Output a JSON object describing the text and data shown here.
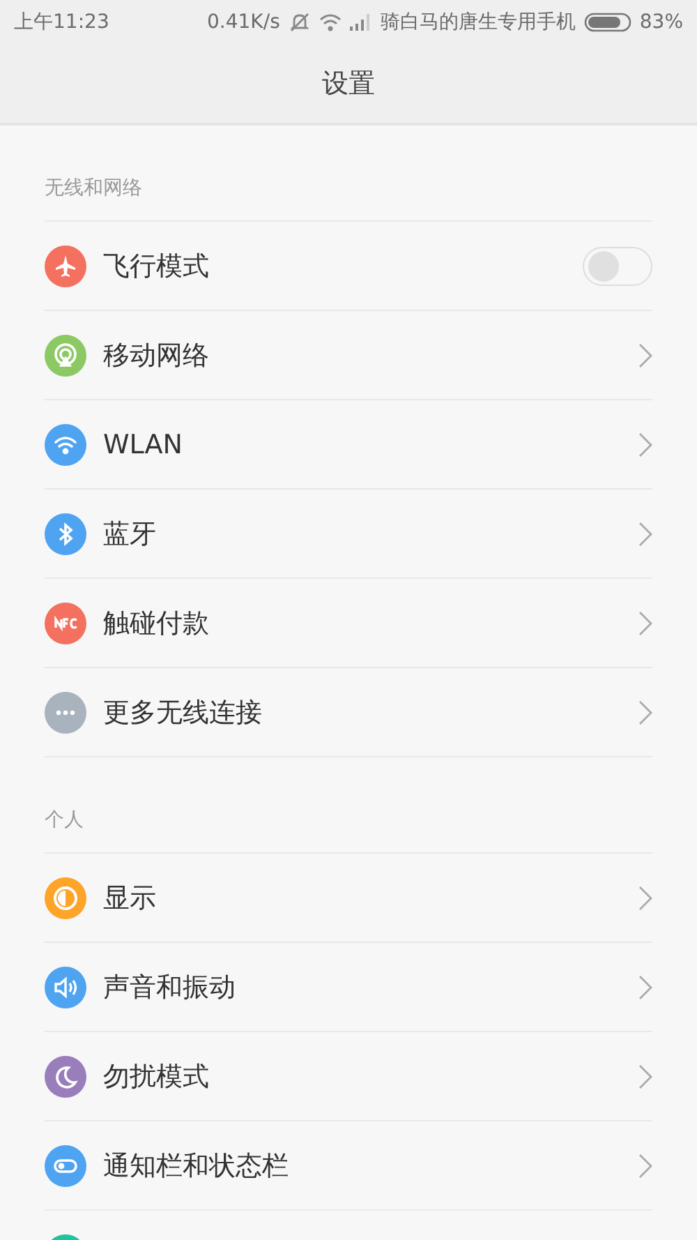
{
  "status_bar": {
    "time": "上午11:23",
    "speed": "0.41K/s",
    "carrier": "骑白马的唐生专用手机",
    "battery": "83%"
  },
  "title": "设置",
  "sections": [
    {
      "header": "无线和网络",
      "items": [
        {
          "label": "飞行模式",
          "kind": "toggle",
          "on": false,
          "color": "#f4705f"
        },
        {
          "label": "移动网络",
          "kind": "link",
          "color": "#8cc964"
        },
        {
          "label": "WLAN",
          "kind": "link",
          "color": "#4fa4f2"
        },
        {
          "label": "蓝牙",
          "kind": "link",
          "color": "#4fa4f2"
        },
        {
          "label": "触碰付款",
          "kind": "link",
          "color": "#f4705f"
        },
        {
          "label": "更多无线连接",
          "kind": "link",
          "color": "#a8b3bd"
        }
      ]
    },
    {
      "header": "个人",
      "items": [
        {
          "label": "显示",
          "kind": "link",
          "color": "#fda429"
        },
        {
          "label": "声音和振动",
          "kind": "link",
          "color": "#4fa4f2"
        },
        {
          "label": "勿扰模式",
          "kind": "link",
          "color": "#9a7dbb"
        },
        {
          "label": "通知栏和状态栏",
          "kind": "link",
          "color": "#4fa4f2"
        },
        {
          "kind": "cut",
          "color": "#1fc49a"
        }
      ]
    }
  ]
}
